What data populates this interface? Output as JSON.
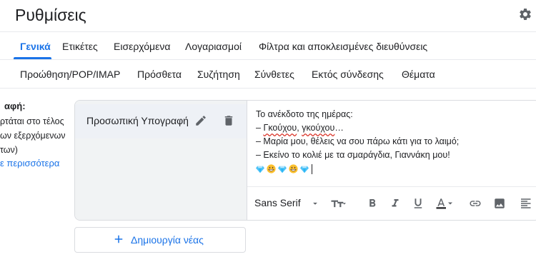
{
  "header": {
    "title": "Ρυθμίσεις",
    "settings_icon": "gear-icon"
  },
  "tabs_row1": [
    {
      "label": "Γενικά",
      "active": true
    },
    {
      "label": "Ετικέτες"
    },
    {
      "label": "Εισερχόμενα"
    },
    {
      "label": "Λογαριασμοί"
    },
    {
      "label": "Φίλτρα και αποκλεισμένες διευθύνσεις"
    }
  ],
  "tabs_row2": [
    {
      "label": "Προώθηση/POP/IMAP"
    },
    {
      "label": "Πρόσθετα"
    },
    {
      "label": "Συζήτηση"
    },
    {
      "label": "Σύνθετες"
    },
    {
      "label": "Εκτός σύνδεσης"
    },
    {
      "label": "Θέματα"
    }
  ],
  "left_partial": {
    "heading": "αφή:",
    "line1": "ρτάται στο τέλος",
    "line2": "ων εξερχόμενων",
    "line3": "των)",
    "link": "ε περισσότερα"
  },
  "signature": {
    "name": "Προσωπική Υπογραφή",
    "line1": "Το ανέκδοτο της ημέρας:",
    "line2_prefix": "– ",
    "line2_word1": "Γκούχου",
    "line2_sep": ", ",
    "line2_word2": "γκούχου",
    "line2_suffix": "…",
    "line3": "– Μαρία μου, θέλεις να σου πάρω κάτι για το λαιμό;",
    "line4": "– Εκείνο το κολιέ με τα σμαράγδια, Γιαννάκη μου!",
    "emoji_sequence": [
      "gem",
      "grinning-face",
      "gem",
      "grinning-face",
      "gem"
    ]
  },
  "toolbar": {
    "font": "Sans Serif"
  },
  "create_button": {
    "label": "Δημιουργία νέας"
  },
  "colors": {
    "accent": "#1a73e8",
    "icon": "#5f6368",
    "spell_error": "#d93025"
  }
}
